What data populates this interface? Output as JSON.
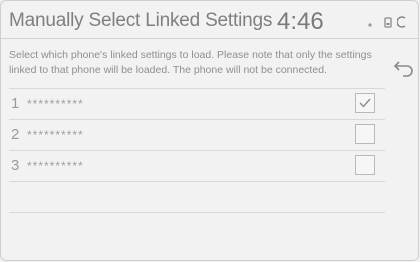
{
  "header": {
    "title": "Manually Select Linked Settings",
    "clock": "4:46"
  },
  "status_icons": [
    "signal-dot-icon",
    "phone-icon",
    "partial-icon"
  ],
  "instructions": "Select which phone's linked settings to load. Please note that only the settings linked to that phone will be loaded. The phone will not be connected.",
  "back_button": {
    "icon": "return-arrow-icon"
  },
  "rows": [
    {
      "num": "1",
      "device": "**********",
      "checked": true
    },
    {
      "num": "2",
      "device": "**********",
      "checked": false
    },
    {
      "num": "3",
      "device": "**********",
      "checked": false
    }
  ],
  "colors": {
    "background": "#f2f2f2",
    "text": "#8a8a8a",
    "divider": "#d8d8d8"
  }
}
